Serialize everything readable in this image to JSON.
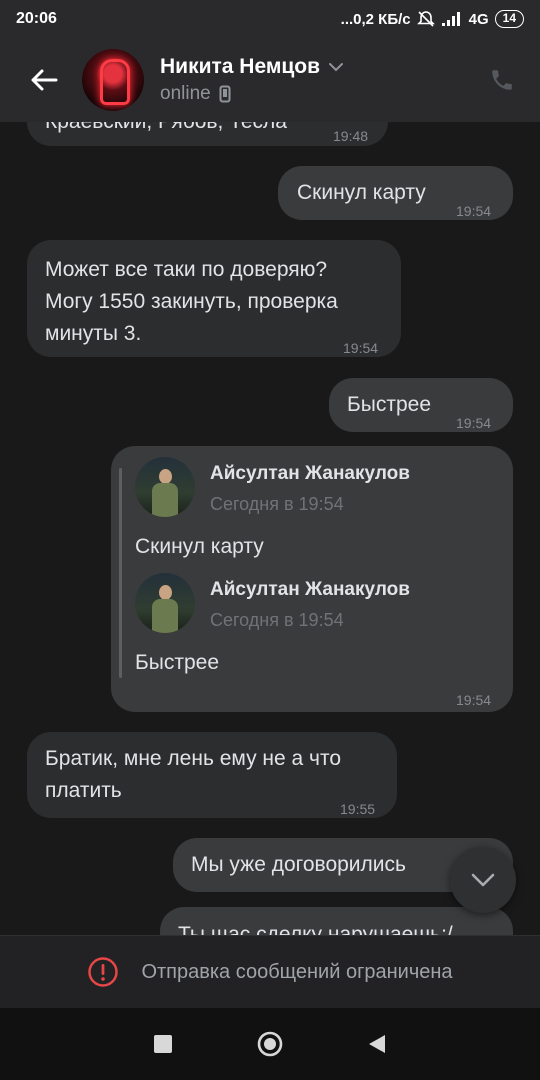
{
  "status_bar": {
    "time": "20:06",
    "network": "...0,2 КБ/с",
    "signal": "4G",
    "battery": "14"
  },
  "header": {
    "contact_name": "Никита Немцов",
    "contact_status": "online"
  },
  "messages": [
    {
      "direction": "in",
      "text": "Краевский, Рябов, Тесла",
      "time": "19:48"
    },
    {
      "direction": "out",
      "text": "Скинул карту",
      "time": "19:54"
    },
    {
      "direction": "in",
      "lines": [
        "Может все таки по доверяю?",
        "Могу 1550 закинуть, проверка",
        "минуты 3."
      ],
      "time": "19:54"
    },
    {
      "direction": "out",
      "text": "Быстрее",
      "time": "19:54"
    },
    {
      "direction": "out",
      "time": "19:54",
      "forwarded": [
        {
          "author": "Айсултан Жанакулов",
          "date": "Сегодня в 19:54",
          "text": "Скинул карту"
        },
        {
          "author": "Айсултан Жанакулов",
          "date": "Сегодня в 19:54",
          "text": "Быстрее"
        }
      ]
    },
    {
      "direction": "in",
      "lines": [
        "Братик, мне лень ему не а что",
        "платить"
      ],
      "time": "19:55"
    },
    {
      "direction": "out",
      "text": "Мы уже договорились"
    },
    {
      "direction": "out",
      "text": "Ты щас сделку нарушаешь:/"
    }
  ],
  "restriction": {
    "text": "Отправка сообщений ограничена",
    "icon": "alert-icon",
    "color": "#e64646"
  },
  "colors": {
    "background": "#19191a",
    "bar": "#2a2a2c",
    "bubble_in": "#2c2d2e",
    "bubble_out": "#3a3b3c"
  }
}
